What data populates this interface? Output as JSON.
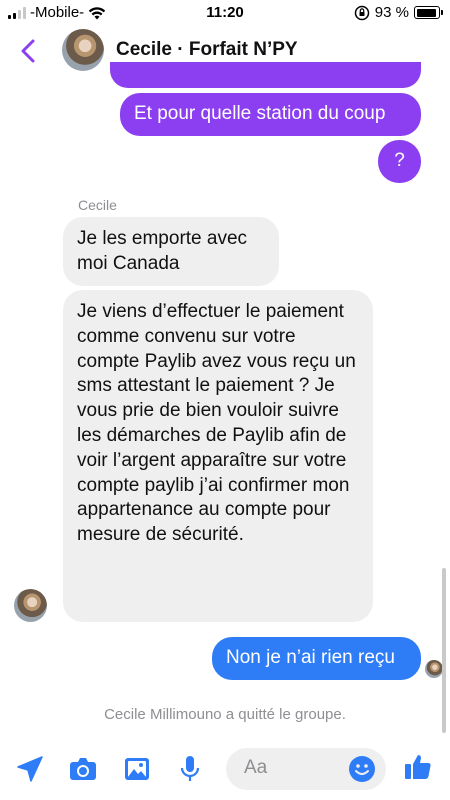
{
  "status_bar": {
    "carrier": "-Mobile-",
    "time": "11:20",
    "battery_percent": "93 %",
    "battery_level": 0.93
  },
  "header": {
    "title": "Cecile · Forfait N’PY"
  },
  "messages": {
    "out_1": "Et pour quelle station du coup",
    "out_2": "?",
    "sender_name": "Cecile",
    "in_1": "Je les emporte avec moi Canada",
    "in_2": "Je viens d’effectuer le paiement comme convenu sur votre compte Paylib avez vous reçu un sms attestant le paiement ? Je vous prie de bien vouloir suivre les démarches de Paylib afin de voir l’argent apparaître sur votre compte paylib j’ai confirmer mon appartenance au compte pour mesure de sécurité.",
    "out_3": "Non je n’ai rien reçu",
    "system_notice": "Cecile Millimouno a quitté le groupe."
  },
  "composer": {
    "placeholder": "Aa"
  },
  "icons": {
    "back": "chevron-left-icon",
    "location": "location-arrow-icon",
    "camera": "camera-icon",
    "gallery": "image-icon",
    "microphone": "microphone-icon",
    "emoji": "emoji-icon",
    "like": "thumbs-up-icon"
  },
  "colors": {
    "accent_purple": "#8b3ff0",
    "accent_blue": "#2f7df6",
    "incoming_bubble": "#efefef"
  }
}
